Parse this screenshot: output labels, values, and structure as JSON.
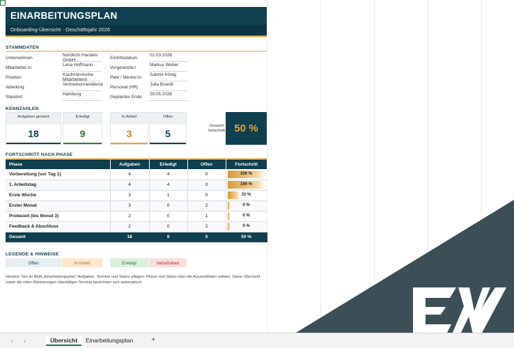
{
  "header": {
    "title": "EINARBEITUNGSPLAN",
    "subtitle": "Onboarding-Übersicht  ·  Geschäftsjahr 2026"
  },
  "stammdaten": {
    "heading": "STAMMDATEN",
    "left": [
      {
        "label": "Unternehmen",
        "value": "Nordlicht Handels GmbH"
      },
      {
        "label": "Mitarbeiter:in",
        "value": "Lena Hoffmann"
      },
      {
        "label": "Position",
        "value": "Kaufmännische Mitarbeiterin"
      },
      {
        "label": "Abteilung",
        "value": "Vertriebsinnendienst"
      },
      {
        "label": "Standort",
        "value": "Hamburg"
      }
    ],
    "right": [
      {
        "label": "Eintrittsdatum",
        "value": "02.03.2026"
      },
      {
        "label": "Vorgesetzte:r",
        "value": "Markus Weber"
      },
      {
        "label": "Pate / Mentor:in",
        "value": "Sabine König"
      },
      {
        "label": "Personal (HR)",
        "value": "Julia Brandt"
      },
      {
        "label": "Geplantes Ende",
        "value": "29.05.2026"
      }
    ]
  },
  "kennzahlen": {
    "heading": "KENNZAHLEN",
    "aufgaben_label": "Aufgaben gesamt",
    "aufgaben": "18",
    "erledigt_label": "Erledigt",
    "erledigt": "9",
    "inarbeit_label": "In Arbeit",
    "inarbeit": "3",
    "offen_label": "Offen",
    "offen": "5",
    "gesamt_label": "Gesamt-fortschritt",
    "gesamt": "50 %"
  },
  "fortschritt": {
    "heading": "FORTSCHRITT NACH PHASE",
    "columns": [
      "Phase",
      "Aufgaben",
      "Erledigt",
      "Offen",
      "Fortschritt"
    ],
    "rows": [
      {
        "phase": "Vorbereitung (vor Tag 1)",
        "aufgaben": "4",
        "erledigt": "4",
        "offen": "0",
        "progress": "100 %",
        "fraction": 1.0
      },
      {
        "phase": "1. Arbeitstag",
        "aufgaben": "4",
        "erledigt": "4",
        "offen": "0",
        "progress": "100 %",
        "fraction": 1.0
      },
      {
        "phase": "Erste Woche",
        "aufgaben": "3",
        "erledigt": "1",
        "offen": "0",
        "progress": "33 %",
        "fraction": 0.33
      },
      {
        "phase": "Erster Monat",
        "aufgaben": "3",
        "erledigt": "0",
        "offen": "2",
        "progress": "0 %",
        "fraction": 0.0
      },
      {
        "phase": "Probezeit (bis Monat 3)",
        "aufgaben": "2",
        "erledigt": "0",
        "offen": "1",
        "progress": "0 %",
        "fraction": 0.0
      },
      {
        "phase": "Feedback & Abschluss",
        "aufgaben": "2",
        "erledigt": "0",
        "offen": "2",
        "progress": "0 %",
        "fraction": 0.0
      }
    ],
    "total": {
      "phase": "Gesamt",
      "aufgaben": "18",
      "erledigt": "9",
      "offen": "5",
      "progress": "50 %"
    }
  },
  "legende": {
    "heading": "LEGENDE & HINWEISE",
    "items": [
      {
        "label": "Offen",
        "bg": "#e7eef2",
        "color": "#103f4f"
      },
      {
        "label": "In Arbeit",
        "bg": "#fbe7cf",
        "color": "#b86e16"
      },
      {
        "label": "Erledigt",
        "bg": "#dcefdf",
        "color": "#2e7d32"
      },
      {
        "label": "Verschoben",
        "bg": "#f8dede",
        "color": "#b3261e"
      }
    ],
    "hint": "Hinweis: Nur im Blatt „Einarbeitungsplan“ Aufgaben, Termine und Status pflegen: Phase und Status über die Auswahllisten wählen. Diese Übersicht sowie die roten Markierungen überfälliger Termine berechnen sich automatisch."
  },
  "sheet_tabs": {
    "prev": "‹",
    "next": "›",
    "tabs": [
      "Übersicht",
      "Einarbeitungsplan"
    ],
    "add": "+"
  },
  "colors": {
    "navy": "#103f4f",
    "gold": "#e8a33b",
    "green": "#2e7d32",
    "overlay": "#3c4f57"
  },
  "watermark": {
    "logo": "EW"
  }
}
